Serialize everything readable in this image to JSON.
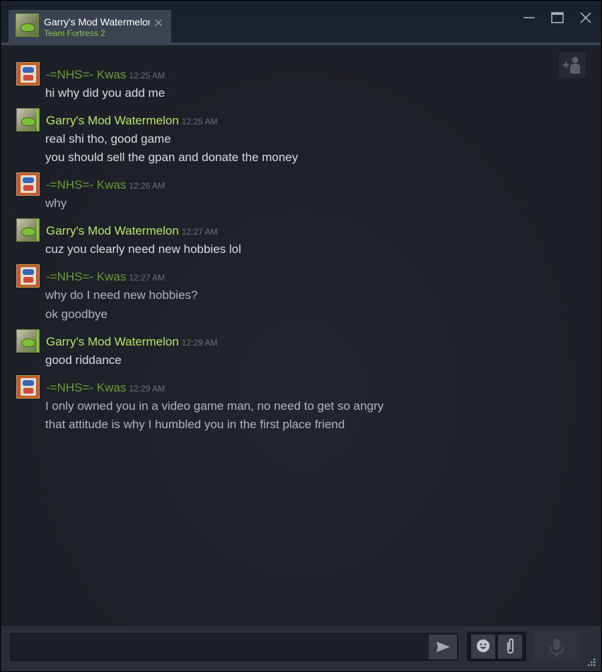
{
  "tab": {
    "title": "Garry's Mod Watermelon",
    "subtitle": "Team Fortress 2"
  },
  "window_controls": {
    "minimize": "minimize-icon",
    "maximize": "maximize-icon",
    "close": "close-icon"
  },
  "colors": {
    "ingame_green": "#8bc53f",
    "name_kwas": "#6a9a38",
    "name_gmw": "#b7e36b",
    "background": "#1c1f25"
  },
  "messages": [
    {
      "sender": "-=NHS=- Kwas",
      "time": "12:25 AM",
      "lines": [
        "hi why did you add me"
      ]
    },
    {
      "sender": "Garry's Mod Watermelon",
      "time": "12:25 AM",
      "lines": [
        "real shi tho, good game",
        "you should sell the gpan and donate the money"
      ]
    },
    {
      "sender": "-=NHS=- Kwas",
      "time": "12:26 AM",
      "lines": [
        "why"
      ]
    },
    {
      "sender": "Garry's Mod Watermelon",
      "time": "12:27 AM",
      "lines": [
        "cuz you clearly need new hobbies lol"
      ]
    },
    {
      "sender": "-=NHS=- Kwas",
      "time": "12:27 AM",
      "lines": [
        "why do I need new hobbies?",
        "ok goodbye"
      ]
    },
    {
      "sender": "Garry's Mod Watermelon",
      "time": "12:29 AM",
      "lines": [
        "good riddance"
      ]
    },
    {
      "sender": "-=NHS=- Kwas",
      "time": "12:29 AM",
      "lines": [
        "I only owned you in a video game man, no need to get so angry",
        "that attitude is why I humbled you in the first place friend"
      ]
    }
  ],
  "input": {
    "value": "",
    "placeholder": ""
  }
}
